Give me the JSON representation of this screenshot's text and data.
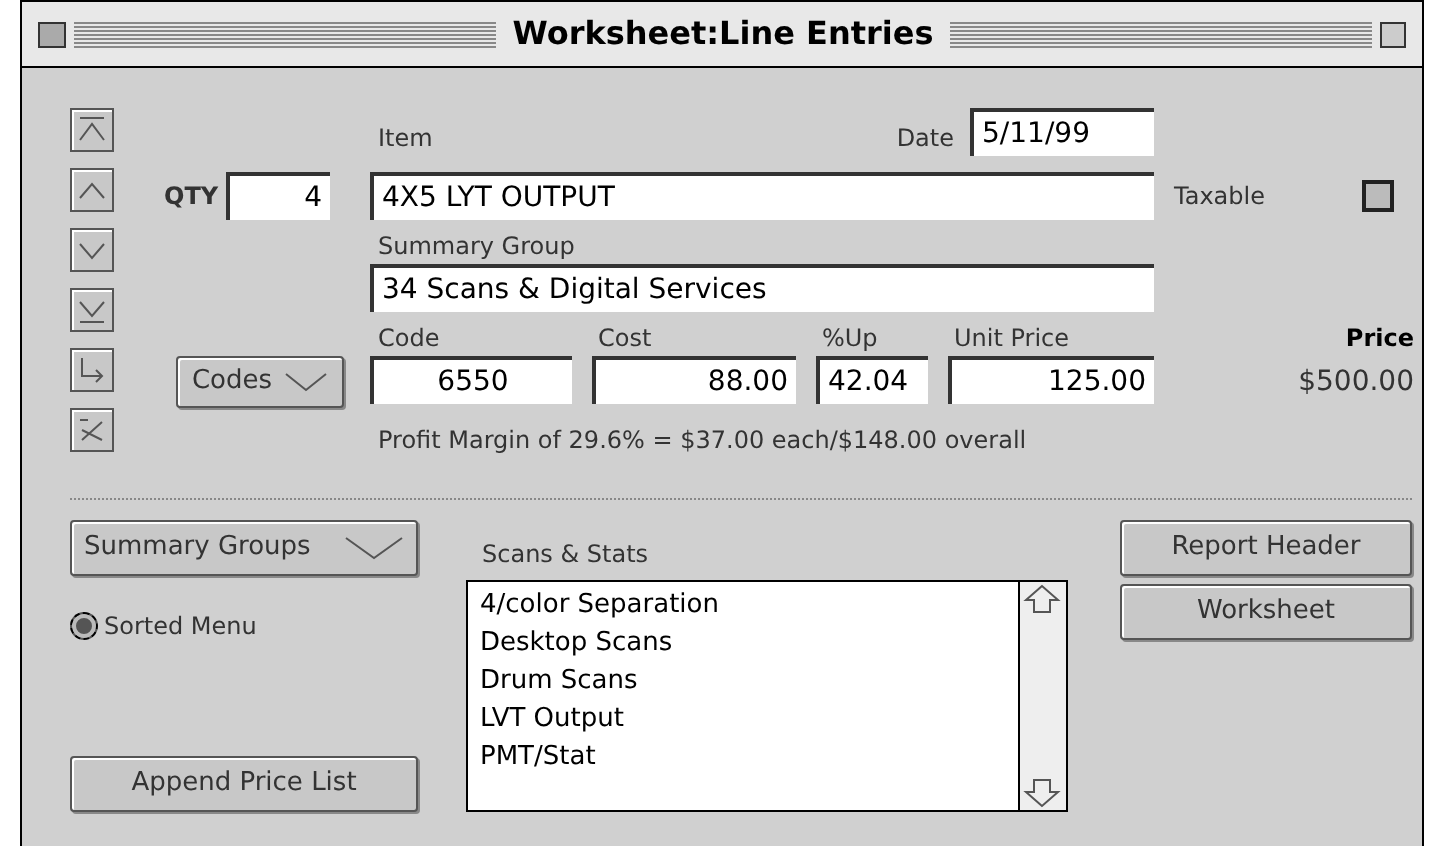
{
  "window": {
    "title": "Worksheet:Line Entries"
  },
  "qty": {
    "label": "QTY",
    "value": "4"
  },
  "item": {
    "label": "Item",
    "value": "4X5 LYT OUTPUT"
  },
  "date": {
    "label": "Date",
    "value": "5/11/99"
  },
  "taxable": {
    "label": "Taxable",
    "checked": false
  },
  "summary_group": {
    "label": "Summary Group",
    "value": "34 Scans & Digital Services"
  },
  "codes_button": {
    "label": "Codes"
  },
  "code": {
    "label": "Code",
    "value": "6550"
  },
  "cost": {
    "label": "Cost",
    "value": "88.00"
  },
  "markup": {
    "label": "%Up",
    "value": "42.04"
  },
  "unit_price": {
    "label": "Unit Price",
    "value": "125.00"
  },
  "price": {
    "label": "Price",
    "value": "$500.00"
  },
  "profit_margin": "Profit Margin of 29.6% = $37.00 each/$148.00 overall",
  "summary_groups_menu": {
    "label": "Summary Groups"
  },
  "sorted_menu": {
    "label": "Sorted Menu",
    "selected": true
  },
  "list": {
    "title": "Scans & Stats",
    "items": [
      "4/color Separation",
      "Desktop Scans",
      "Drum Scans",
      "LVT Output",
      "PMT/Stat"
    ]
  },
  "append_button": {
    "label": "Append Price List"
  },
  "side_buttons": [
    "Report Header",
    "Worksheet"
  ]
}
